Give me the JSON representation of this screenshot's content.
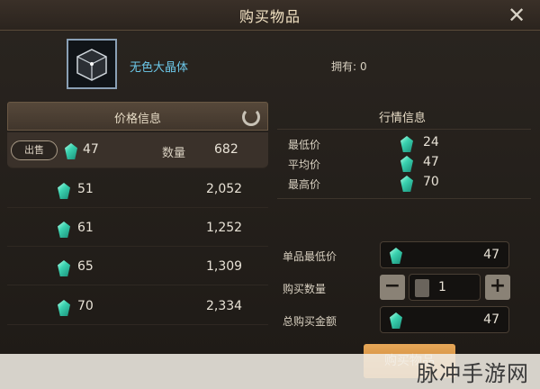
{
  "dialog": {
    "title": "购买物品",
    "close_icon": "close-icon"
  },
  "item": {
    "name": "无色大晶体",
    "icon": "crystal-cube-icon",
    "owned_label": "拥有:",
    "owned_value": "0"
  },
  "price_panel": {
    "header": "价格信息",
    "refresh_icon": "refresh-icon",
    "sell_badge": "出售",
    "qty_label": "数量",
    "rows": [
      {
        "price": "47",
        "qty": "682"
      },
      {
        "price": "51",
        "qty": "2,052"
      },
      {
        "price": "61",
        "qty": "1,252"
      },
      {
        "price": "65",
        "qty": "1,309"
      },
      {
        "price": "70",
        "qty": "2,334"
      }
    ]
  },
  "market": {
    "title": "行情信息",
    "rows": [
      {
        "label": "最低价",
        "value": "24"
      },
      {
        "label": "平均价",
        "value": "47"
      },
      {
        "label": "最高价",
        "value": "70"
      }
    ]
  },
  "form": {
    "unit_price_label": "单品最低价",
    "unit_price": "47",
    "quantity_label": "购买数量",
    "quantity": "1",
    "minus": "−",
    "plus": "+",
    "total_label": "总购买金额",
    "total": "47",
    "buy_button": "购买物品"
  },
  "watermark": "脉冲手游网",
  "colors": {
    "accent": "#6cc7e8",
    "gem": "#3bd3b0",
    "buy_button": "#d88f3c"
  }
}
